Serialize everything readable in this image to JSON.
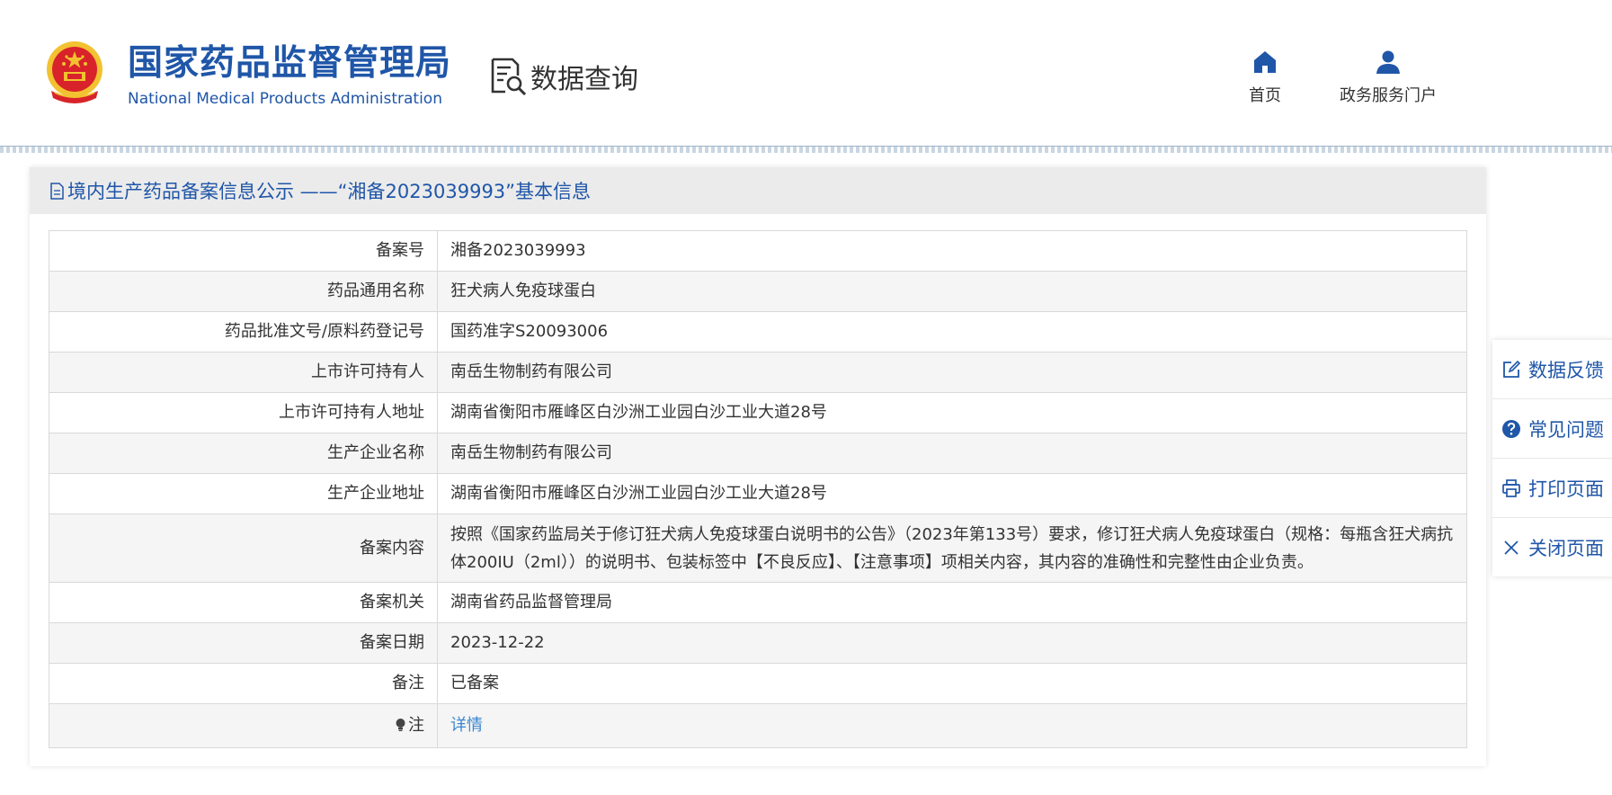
{
  "header": {
    "logo_cn": "国家药品监督管理局",
    "logo_en": "National Medical Products Administration",
    "data_query": "数据查询",
    "nav": {
      "home": "首页",
      "gov_portal": "政务服务门户"
    }
  },
  "panel": {
    "title": "境内生产药品备案信息公示 ——“湘备2023039993”基本信息",
    "rows": [
      {
        "label": "备案号",
        "value": "湘备2023039993"
      },
      {
        "label": "药品通用名称",
        "value": "狂犬病人免疫球蛋白"
      },
      {
        "label": "药品批准文号/原料药登记号",
        "value": "国药准字S20093006"
      },
      {
        "label": "上市许可持有人",
        "value": "南岳生物制药有限公司"
      },
      {
        "label": "上市许可持有人地址",
        "value": "湖南省衡阳市雁峰区白沙洲工业园白沙工业大道28号"
      },
      {
        "label": "生产企业名称",
        "value": "南岳生物制药有限公司"
      },
      {
        "label": "生产企业地址",
        "value": "湖南省衡阳市雁峰区白沙洲工业园白沙工业大道28号"
      },
      {
        "label": "备案内容",
        "value": "按照《国家药监局关于修订狂犬病人免疫球蛋白说明书的公告》（2023年第133号）要求，修订狂犬病人免疫球蛋白（规格：每瓶含狂犬病抗体200IU（2ml））的说明书、包装标签中【不良反应】、【注意事项】项相关内容，其内容的准确性和完整性由企业负责。"
      },
      {
        "label": "备案机关",
        "value": "湖南省药品监督管理局"
      },
      {
        "label": "备案日期",
        "value": "2023-12-22"
      },
      {
        "label": "备注",
        "value": "已备案"
      },
      {
        "label": "注",
        "value": "详情"
      }
    ]
  },
  "float_menu": {
    "feedback": "数据反馈",
    "faq": "常见问题",
    "print": "打印页面",
    "close": "关闭页面"
  },
  "colors": {
    "brand_blue": "#1f56a8",
    "link_blue": "#3a87d1",
    "emblem_red": "#d8232a",
    "emblem_gold": "#f2c230"
  },
  "icons": {
    "home": "home-icon",
    "user": "user-icon",
    "data_query": "document-search-icon",
    "feedback": "edit-icon",
    "faq": "question-circle-icon",
    "print": "printer-icon",
    "close": "close-icon",
    "note": "bulb-icon"
  }
}
